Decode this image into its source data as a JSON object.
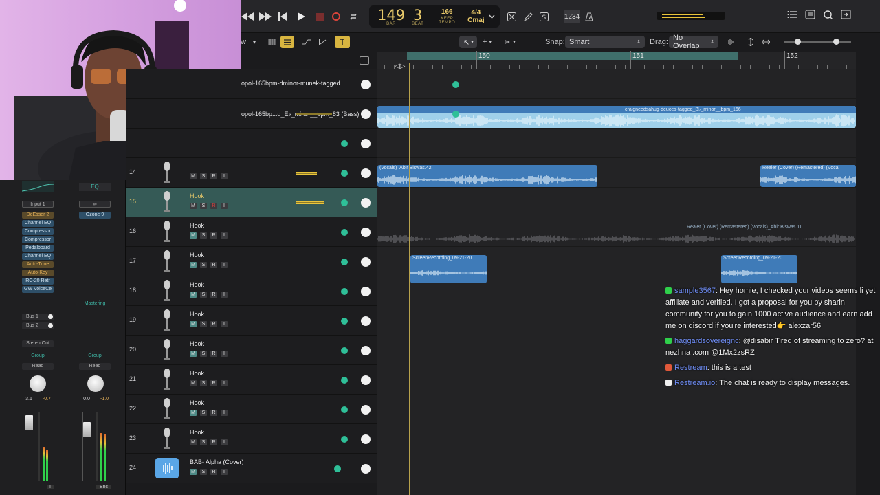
{
  "lcd": {
    "bar": "149",
    "beat": "3",
    "bar_label": "BAR",
    "beat_label": "BEAT",
    "tempo": "166",
    "keep_label": "KEEP",
    "tempo_label": "TEMPO",
    "time_signature": "4/4",
    "key": "Cmaj",
    "count_in": "1234"
  },
  "toolbar": {
    "view_menu": "w",
    "snap_label": "Snap:",
    "snap_value": "Smart",
    "drag_label": "Drag:",
    "drag_value": "No Overlap"
  },
  "ruler": {
    "markers": [
      "150",
      "151",
      "152"
    ]
  },
  "inspector": {
    "eq_label": "EQ",
    "input": "Input 1",
    "link_icon": "link-icon",
    "ozone": "Ozone 9",
    "plugins": [
      "DeEsser 2",
      "Channel EQ",
      "Compressor",
      "Compressor",
      "Pedalboard",
      "Channel EQ",
      "Auto-Tune",
      "Auto-Key",
      "RC-20 Retr",
      "GW VoiceCe"
    ],
    "mastering": "Mastering",
    "bus1": "Bus 1",
    "bus2": "Bus 2",
    "stereo_out": "Stereo Out",
    "group_left": "Group",
    "group_right": "Group",
    "read_left": "Read",
    "read_right": "Read",
    "vol_left": "3.1",
    "peak_left": "-0.7",
    "vol_right": "0.0",
    "peak_right": "-1.0",
    "bnc": "Bnc",
    "i_left": "I"
  },
  "tracks": [
    {
      "num": "",
      "name": "opol-165bpm-dminor-munek-tagged"
    },
    {
      "num": "",
      "name": "opol-165bp...d_E♭_minor__bpm_83 (Bass)"
    },
    {
      "num": "",
      "name": ""
    },
    {
      "num": "14",
      "name": ""
    },
    {
      "num": "15",
      "name": "Hook"
    },
    {
      "num": "16",
      "name": "Hook"
    },
    {
      "num": "17",
      "name": "Hook"
    },
    {
      "num": "18",
      "name": "Hook"
    },
    {
      "num": "19",
      "name": "Hook"
    },
    {
      "num": "20",
      "name": "Hook"
    },
    {
      "num": "21",
      "name": "Hook"
    },
    {
      "num": "22",
      "name": "Hook"
    },
    {
      "num": "23",
      "name": "Hook"
    },
    {
      "num": "24",
      "name": "BAB- Alpha (Cover)"
    }
  ],
  "track_buttons": {
    "m": "M",
    "s": "S",
    "r": "R",
    "i": "I"
  },
  "regions": {
    "bass": "craigneedsahug-deuces-tagged_B♭_minor__bpm_166",
    "vocals_a": "(Vocals)_Abir Biswas.42",
    "vocals_b": "Realer (Cover) (Remastered) (Vocal",
    "vocals_c": "Realer (Cover) (Remastered) (Vocals)_Abir Biswas.11",
    "screen_a": "ScreenRecording_09-21-20",
    "screen_b": "ScreenRecording_09-21-20"
  },
  "chat": [
    {
      "user": "sample3567",
      "sep": ":",
      "text": " Hey homie, I checked your videos seems li yet affiliate and verified. I got a proposal for you by sharin community for you to gain 1000 active audience and earn add me on discord if you're interested👉 alexzar56",
      "badge_color": "#2fd04b"
    },
    {
      "user": "haggardsovereignc",
      "sep": ":",
      "text": " @disabir Tired of streaming to zero? at nezhna .com @1Mx2zsRZ",
      "badge_color": "#2fd04b"
    },
    {
      "user": "Restream",
      "sep": ":",
      "text": " this is a test",
      "badge_color": "#e0583a"
    },
    {
      "user": "Restream.io",
      "sep": ":",
      "text": " The chat is ready to display messages.",
      "badge_color": "#f0f0f0"
    }
  ],
  "colors": {
    "accent_yellow": "#e7c86a",
    "track_selected": "#355a56",
    "region_blue": "#3f7bb8",
    "region_light": "#9fd0ea",
    "chat_user": "#6f8df5"
  }
}
